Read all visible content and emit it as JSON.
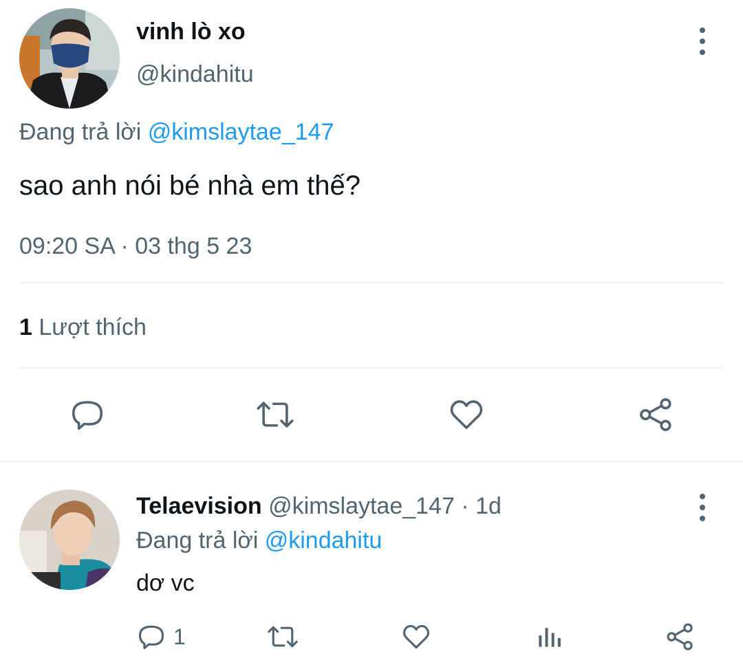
{
  "main_tweet": {
    "author_name": "vinh lò xo",
    "author_handle": "@kindahitu",
    "replying_prefix": "Đang trả lời",
    "replying_to": "@kimslaytae_147",
    "text": "sao anh nói bé nhà em thế?",
    "timestamp": "09:20 SA · 03 thg 5 23",
    "likes_count": "1",
    "likes_label": "Lượt thích",
    "actions": [
      "reply-icon",
      "retweet-icon",
      "like-icon",
      "share-icon"
    ]
  },
  "reply_tweet": {
    "author_name": "Telaevision",
    "author_handle": "@kimslaytae_147",
    "separator": "·",
    "age": "1d",
    "replying_prefix": "Đang trả lời",
    "replying_to": "@kindahitu",
    "text": "dơ vc",
    "reply_count": "1",
    "actions": [
      "reply-icon",
      "retweet-icon",
      "like-icon",
      "views-icon",
      "share-icon"
    ]
  },
  "colors": {
    "text": "#0f1419",
    "secondary": "#536471",
    "accent": "#1d9bf0",
    "divider": "#eff3f4"
  }
}
